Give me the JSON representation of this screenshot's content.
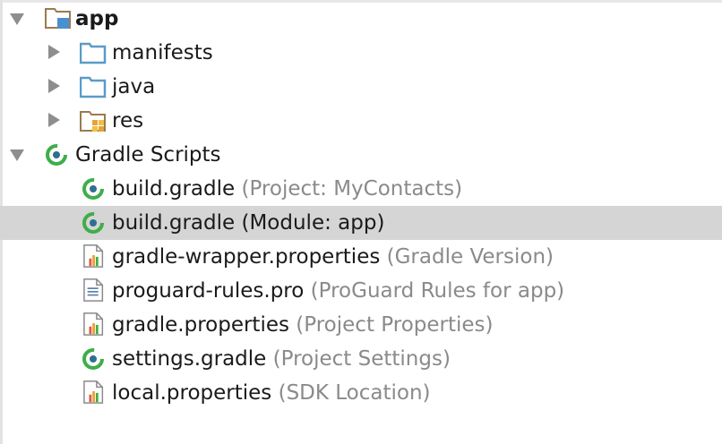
{
  "tree": {
    "app": {
      "label": "app"
    },
    "manifests": {
      "label": "manifests"
    },
    "java": {
      "label": "java"
    },
    "res": {
      "label": "res"
    },
    "gradle_scripts": {
      "label": "Gradle Scripts"
    },
    "files": [
      {
        "name": "build.gradle",
        "hint": "(Project: MyContacts)",
        "icon": "gradle-icon"
      },
      {
        "name": "build.gradle",
        "hint": "(Module: app)",
        "icon": "gradle-icon",
        "selected": true
      },
      {
        "name": "gradle-wrapper.properties",
        "hint": "(Gradle Version)",
        "icon": "properties-file-icon"
      },
      {
        "name": "proguard-rules.pro",
        "hint": "(ProGuard Rules for app)",
        "icon": "text-file-icon"
      },
      {
        "name": "gradle.properties",
        "hint": "(Project Properties)",
        "icon": "properties-file-icon"
      },
      {
        "name": "settings.gradle",
        "hint": "(Project Settings)",
        "icon": "gradle-icon"
      },
      {
        "name": "local.properties",
        "hint": "(SDK Location)",
        "icon": "properties-file-icon"
      }
    ]
  },
  "colors": {
    "selection": "#d5d5d5",
    "folder_blue": "#5b9bc7",
    "gradle_green": "#3fae49",
    "hint_gray": "#8a8a8a"
  }
}
